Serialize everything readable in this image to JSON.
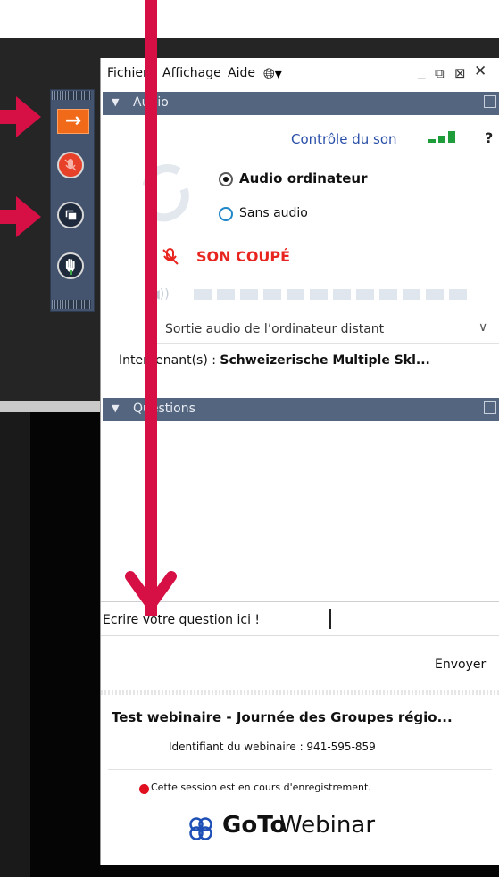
{
  "menu": {
    "file": "Fichier",
    "view": "Affichage",
    "help": "Aide"
  },
  "audio": {
    "section_title": "Audio",
    "sound_control": "Contrôle du son",
    "help_mark": "?",
    "option_computer": "Audio ordinateur",
    "option_none": "Sans audio",
    "selected_option": "Audio ordinateur",
    "muted_status": "SON COUPÉ",
    "output_select": "Sortie audio de l’ordinateur distant",
    "speakers_label": "Intervenant(s) :",
    "speakers_value": "Schweizerische Multiple Skl..."
  },
  "questions": {
    "section_title": "Questions",
    "input_value": "Ecrire votre question ici !",
    "send_button": "Envoyer"
  },
  "webinar": {
    "title": "Test webinaire - Journée des Groupes régio...",
    "id_label": "Identifiant du webinaire : 941-595-859",
    "recording_notice": "Cette session est en cours d'enregistrement.",
    "brand_bold": "GoTo",
    "brand_light": "Webinar"
  },
  "colors": {
    "accent_arrow": "#d60f45",
    "header_bar": "#54657f",
    "muted_red": "#e8251f",
    "orange_button": "#f06a1a"
  },
  "icons": [
    "arrow-right-icon",
    "mic-off-icon",
    "screen-share-icon",
    "raise-hand-icon",
    "globe-icon",
    "speaker-icon",
    "signal-bars-icon",
    "gotowebinar-logo-icon"
  ]
}
